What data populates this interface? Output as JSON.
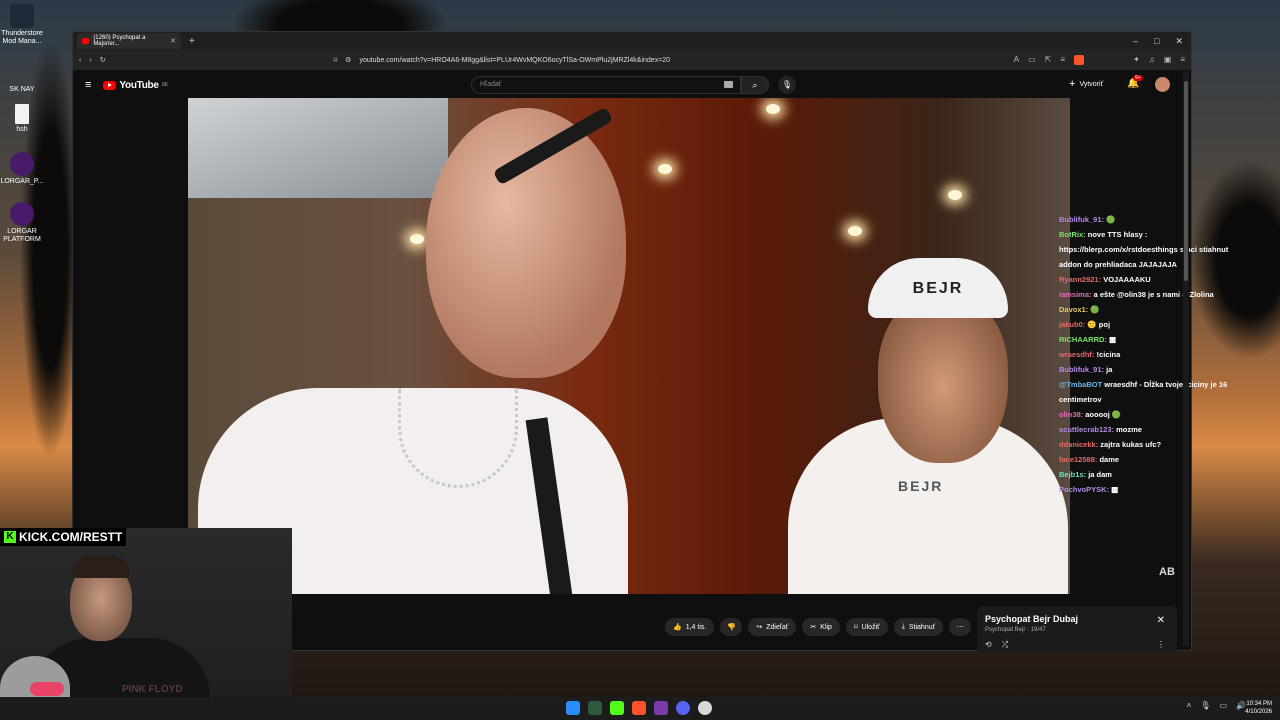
{
  "desktop": {
    "icons": [
      {
        "label": "Thunderstore Mod Mana...",
        "icon": "thunderstore-icon"
      },
      {
        "label": "SK NAY",
        "icon": "shortcut-icon"
      },
      {
        "label": "hsh",
        "icon": "file-icon"
      },
      {
        "label": "LORGAR_P...",
        "icon": "lorgar-icon"
      },
      {
        "label": "LORGAR PLATFORM",
        "icon": "lorgar-icon"
      }
    ]
  },
  "browser": {
    "tab_title": "(1260) Psychopat a Majsner...",
    "url": "youtube.com/watch?v=HRO4A6-M8gg&list=PLUr4WvMQKO6ocyTlSa-OWmPlu2jMRZl4k&index=20"
  },
  "youtube": {
    "logo_text": "YouTube",
    "logo_region": "SK",
    "search_placeholder": "Hľadať",
    "create_label": "Vytvoriť",
    "notifications_badge": "9+"
  },
  "video": {
    "cap_text": "BEJR",
    "shirt_text": "BEJR",
    "watermark": "AB"
  },
  "chat": [
    {
      "user": "Bublifuk_91:",
      "color": "#b48ae6",
      "msg": "🟢"
    },
    {
      "user": "BotRix:",
      "color": "#7be36b",
      "msg": "nove TTS hlasy : https://blerp.com/x/rstdoesthings staci stiahnut addon do prehliadaca JAJAJAJA"
    },
    {
      "user": "Ryann2921:",
      "color": "#e36b6b",
      "msg": "VOJAAAAKU"
    },
    {
      "user": "iamsima:",
      "color": "#e36bb4",
      "msg": "a ešte @olin38 je s nami @Zlolina"
    },
    {
      "user": "Davox1:",
      "color": "#e3c96b",
      "msg": "🟢"
    },
    {
      "user": "jakub0:",
      "color": "#e36b6b",
      "msg": "🙂 poj"
    },
    {
      "user": "RICHAARRD:",
      "color": "#7be36b",
      "msg": "▩"
    },
    {
      "user": "wraesdhf:",
      "color": "#e36b6b",
      "msg": "!cicina"
    },
    {
      "user": "Bublifuk_91:",
      "color": "#b48ae6",
      "msg": "ja"
    },
    {
      "user": "@TmbaBOT",
      "color": "#6bb4e3",
      "msg": "wraesdhf - Dĺžka tvojej ciciny je 16 centimetrov"
    },
    {
      "user": "olin38:",
      "color": "#e36bb4",
      "msg": "aooooj 🟢"
    },
    {
      "user": "scuttlecrab123:",
      "color": "#b48ae6",
      "msg": "mozme"
    },
    {
      "user": "ddanicekk:",
      "color": "#e36b6b",
      "msg": "zajtra kukas ufc?"
    },
    {
      "user": "face12588:",
      "color": "#e36b6b",
      "msg": "dame"
    },
    {
      "user": "Bejb1s:",
      "color": "#6be3c9",
      "msg": "ja dam"
    },
    {
      "user": "PochvoPYSK:",
      "color": "#b48ae6",
      "msg": "▩"
    }
  ],
  "actions": {
    "likes": "1,4 tis.",
    "share": "Zdieľať",
    "clip": "Klip",
    "save": "Uložiť",
    "download": "Stiahnuť"
  },
  "playlist": {
    "title": "Psychopat Bejr  Dubaj",
    "channel": "Psychopat Bejr",
    "position": "19/47"
  },
  "webcam": {
    "kick_text": "KICK.COM/RESTT",
    "shirt_text": "PINK FLOYD"
  },
  "taskbar": {
    "time": "10:34 PM",
    "date": "4/10/2026"
  }
}
